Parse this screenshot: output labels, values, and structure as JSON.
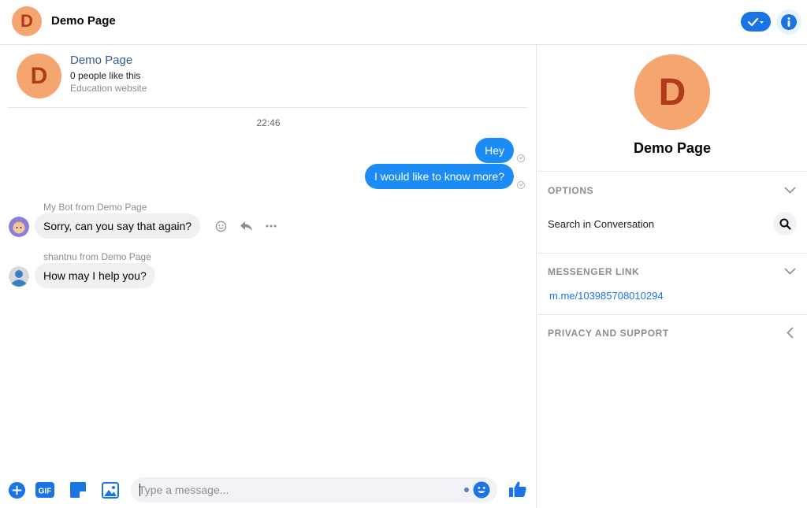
{
  "header": {
    "avatar_letter": "D",
    "title": "Demo Page"
  },
  "page_card": {
    "avatar_letter": "D",
    "name": "Demo Page",
    "likes": "0 people like this",
    "category": "Education website"
  },
  "conversation": {
    "timestamp": "22:46",
    "outgoing": [
      {
        "text": "Hey"
      },
      {
        "text": "I would like to know more?"
      }
    ],
    "incoming": [
      {
        "sender": "My Bot from Demo Page",
        "text": "Sorry, can you say that again?"
      },
      {
        "sender": "shantnu from Demo Page",
        "text": "How may I help you?"
      }
    ]
  },
  "composer": {
    "placeholder": "Type a message...",
    "gif_label": "GIF"
  },
  "info_panel": {
    "avatar_letter": "D",
    "name": "Demo Page",
    "options_heading": "OPTIONS",
    "search_label": "Search in Conversation",
    "messenger_link_heading": "MESSENGER LINK",
    "messenger_link": "m.me/103985708010294",
    "privacy_heading": "PRIVACY AND SUPPORT"
  },
  "colors": {
    "accent": "#1b74e4",
    "outgoing_bubble": "#1b8cf5",
    "avatar_bg": "#f5a66e",
    "avatar_letter": "#b03a1a"
  }
}
